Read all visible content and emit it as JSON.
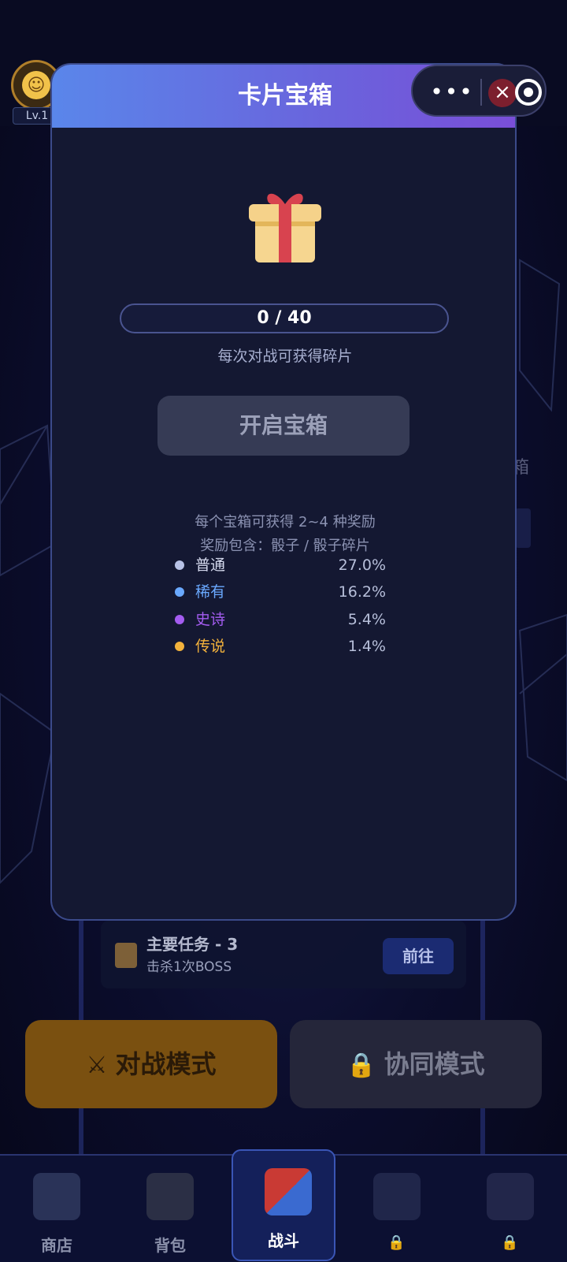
{
  "background": {
    "avatar_level": "Lv.1",
    "side_text": "箱",
    "capsule": {
      "more_icon": "•••",
      "close_icon": "×"
    }
  },
  "modal": {
    "title": "卡片宝箱",
    "progress": {
      "current": 0,
      "total": 40,
      "text": "0 / 40"
    },
    "hint": "每次对战可获得碎片",
    "open_button": "开启宝箱",
    "info_line1": "每个宝箱可获得 2~4 种奖励",
    "info_line2": "奖励包含：骰子 / 骰子碎片",
    "rarities": [
      {
        "name": "普通",
        "percent": "27.0%",
        "color": "#b8c2e6"
      },
      {
        "name": "稀有",
        "percent": "16.2%",
        "color": "#6aa9ff"
      },
      {
        "name": "史诗",
        "percent": "5.4%",
        "color": "#a45cf0"
      },
      {
        "name": "传说",
        "percent": "1.4%",
        "color": "#f3b23c"
      }
    ]
  },
  "quest": {
    "title": "主要任务 - 3",
    "subtitle": "击杀1次BOSS",
    "goto_button": "前往"
  },
  "modes": {
    "battle": "对战模式",
    "coop": "协同模式"
  },
  "tabbar": {
    "items": [
      {
        "label": "商店",
        "locked": false
      },
      {
        "label": "背包",
        "locked": false
      },
      {
        "label": "战斗",
        "locked": false,
        "active": true
      },
      {
        "label": "",
        "locked": true
      },
      {
        "label": "",
        "locked": true
      }
    ]
  }
}
